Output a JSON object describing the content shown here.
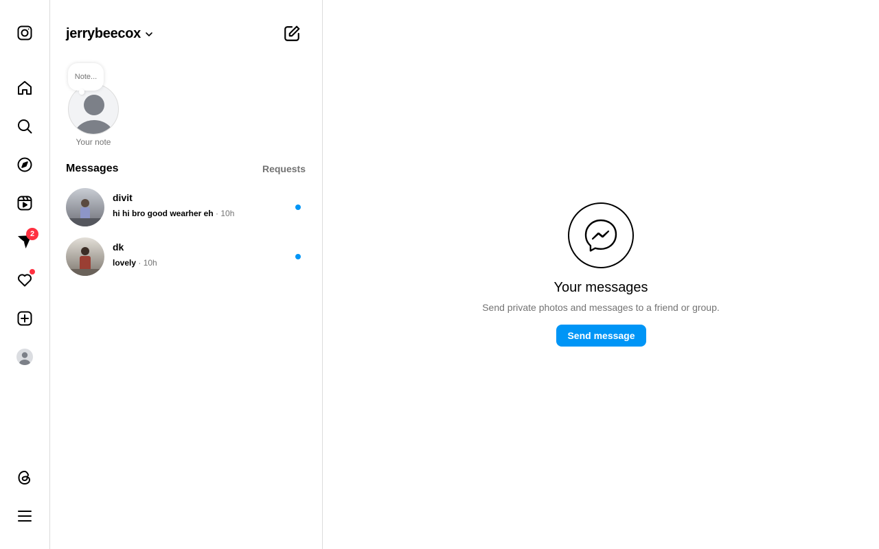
{
  "nav": {
    "items": [
      {
        "icon": "instagram-logo-icon",
        "label": "Instagram"
      },
      {
        "icon": "home-icon",
        "label": "Home"
      },
      {
        "icon": "search-icon",
        "label": "Search"
      },
      {
        "icon": "explore-compass-icon",
        "label": "Explore"
      },
      {
        "icon": "reels-icon",
        "label": "Reels"
      },
      {
        "icon": "messages-icon",
        "label": "Messages"
      },
      {
        "icon": "notifications-heart-icon",
        "label": "Notifications"
      },
      {
        "icon": "create-plus-icon",
        "label": "Create"
      },
      {
        "icon": "profile-avatar-icon",
        "label": "Profile"
      },
      {
        "icon": "threads-icon",
        "label": "Threads"
      },
      {
        "icon": "menu-hamburger-icon",
        "label": "More"
      }
    ],
    "messages_badge": "2",
    "badge_color": "#ff3040"
  },
  "inbox": {
    "account_name": "jerrybeecox",
    "note": {
      "bubble_text": "Note...",
      "label": "Your note"
    },
    "section_title": "Messages",
    "requests_label": "Requests",
    "threads": [
      {
        "name": "divit",
        "last_message": "hi hi bro good wearher eh",
        "separator": " · ",
        "time": "10h",
        "unread": true
      },
      {
        "name": "dk",
        "last_message": "lovely",
        "separator": " · ",
        "time": "10h",
        "unread": true
      }
    ]
  },
  "empty_state": {
    "title": "Your messages",
    "subtitle": "Send private photos and messages to a friend or group.",
    "button_label": "Send message",
    "accent_color": "#0095f6"
  }
}
